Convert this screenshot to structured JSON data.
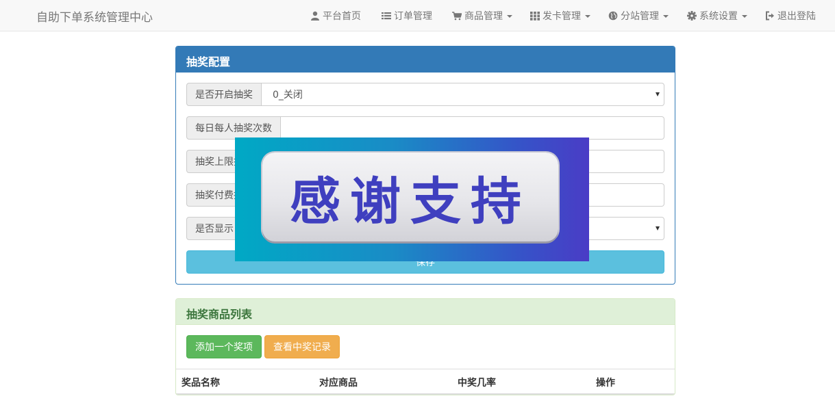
{
  "navbar": {
    "brand": "自助下单系统管理中心",
    "items": [
      {
        "label": "平台首页",
        "icon": "user-icon",
        "dropdown": false
      },
      {
        "label": "订单管理",
        "icon": "list-icon",
        "dropdown": false
      },
      {
        "label": "商品管理",
        "icon": "cart-icon",
        "dropdown": true
      },
      {
        "label": "发卡管理",
        "icon": "grid-icon",
        "dropdown": true
      },
      {
        "label": "分站管理",
        "icon": "globe-icon",
        "dropdown": true
      },
      {
        "label": "系统设置",
        "icon": "gear-icon",
        "dropdown": true
      },
      {
        "label": "退出登陆",
        "icon": "logout-icon",
        "dropdown": false
      }
    ]
  },
  "config_panel": {
    "title": "抽奖配置",
    "fields": [
      {
        "label": "是否开启抽奖",
        "value": "0_关闭",
        "type": "select"
      },
      {
        "label": "每日每人抽奖次数",
        "value": "",
        "type": "input"
      },
      {
        "label": "抽奖上限拦",
        "value": "",
        "type": "input"
      },
      {
        "label": "抽奖付费拦",
        "value": "",
        "type": "input"
      },
      {
        "label": "是否显示",
        "value": "",
        "type": "select"
      }
    ],
    "save_label": "保存"
  },
  "prize_panel": {
    "title": "抽奖商品列表",
    "add_button": "添加一个奖项",
    "records_button": "查看中奖记录",
    "columns": [
      "奖品名称",
      "对应商品",
      "中奖几率",
      "操作"
    ]
  },
  "overlay": {
    "text": "感谢支持"
  },
  "colors": {
    "primary": "#337ab7",
    "info": "#5bc0de",
    "success": "#5cb85c",
    "warning": "#f0ad4e",
    "success_heading_bg": "#dff0d8"
  }
}
